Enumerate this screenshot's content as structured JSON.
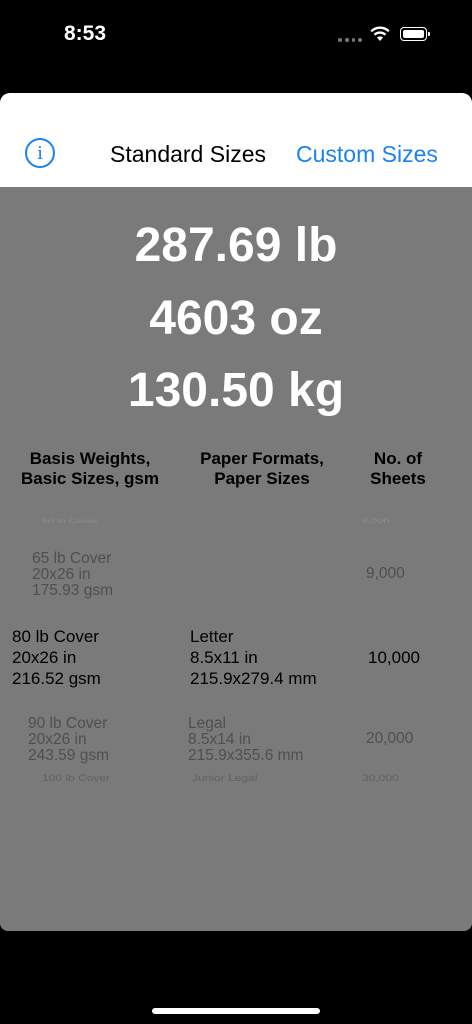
{
  "status": {
    "time": "8:53"
  },
  "nav": {
    "standard_label": "Standard Sizes",
    "custom_label": "Custom Sizes"
  },
  "results": {
    "pounds": "287.69 lb",
    "ounces": "4603 oz",
    "kilograms": "130.50 kg"
  },
  "columns": {
    "basis": "Basis Weights,\nBasic Sizes, gsm",
    "format": "Paper Formats,\nPaper Sizes",
    "sheets": "No. of\nSheets"
  },
  "picker": {
    "faint_top": {
      "basis": "60 lb Cover",
      "sheets": "8,000"
    },
    "above": {
      "basis": "65 lb Cover\n20x26 in\n175.93 gsm",
      "format": "",
      "sheets": "9,000"
    },
    "selected": {
      "basis": "80 lb Cover\n20x26 in\n216.52 gsm",
      "format": "Letter\n8.5x11 in\n215.9x279.4 mm",
      "sheets": "10,000"
    },
    "below": {
      "basis": "90 lb Cover\n20x26 in\n243.59 gsm",
      "format": "Legal\n8.5x14 in\n215.9x355.6 mm",
      "sheets": "20,000"
    },
    "far_below": {
      "basis": "100 lb Cover",
      "format": "Junior Legal",
      "sheets": "30,000"
    }
  }
}
